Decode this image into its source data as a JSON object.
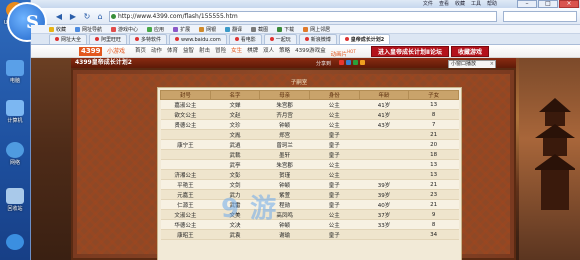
{
  "desktop": {
    "icons": [
      {
        "label": "UC浏览器",
        "color": "#e98b1c"
      },
      {
        "label": "电脑",
        "color": "#5aa0e8"
      },
      {
        "label": "计算机",
        "color": "#7cb7f2"
      },
      {
        "label": "网络",
        "color": "#4f9be0"
      },
      {
        "label": "回收站",
        "color": "#a9c9ea"
      },
      {
        "label": "IE",
        "color": "#3b8fe0"
      }
    ]
  },
  "browser": {
    "system_menu": [
      "文件",
      "查看",
      "收藏",
      "工具",
      "帮助"
    ],
    "url": "http://www.4399.com/flash/155555.htm",
    "bookmarks": [
      {
        "label": "收藏",
        "color": "#e7b416"
      },
      {
        "label": "网址导航",
        "color": "#4c8be0"
      },
      {
        "label": "游戏中心",
        "color": "#e04c4c"
      },
      {
        "label": "应用",
        "color": "#48a848"
      },
      {
        "label": "扩展",
        "color": "#8a58c8"
      },
      {
        "label": "网银",
        "color": "#d08a2a"
      },
      {
        "label": "翻译",
        "color": "#3a9ac8"
      },
      {
        "label": "截图",
        "color": "#7a7a7a"
      },
      {
        "label": "下载",
        "color": "#3a8a3a"
      },
      {
        "label": "网上邻居",
        "color": "#e07a2a"
      }
    ],
    "tabs": [
      {
        "label": "网址大全",
        "active": false
      },
      {
        "label": "阿里旺旺",
        "active": false
      },
      {
        "label": "多特软件",
        "active": false
      },
      {
        "label": "www.baidu.com",
        "active": false
      },
      {
        "label": "看电影",
        "active": false
      },
      {
        "label": "一起玩",
        "active": false
      },
      {
        "label": "新浪微博",
        "active": false
      },
      {
        "label": "皇帝成长计划2",
        "active": true
      }
    ]
  },
  "site": {
    "logo": "4399",
    "logo_text": "小游戏",
    "nav": [
      "首页",
      "动作",
      "体育",
      "益智",
      "射击",
      "冒险",
      "女生",
      "棋牌",
      "双人",
      "策略",
      "4399游戏盒",
      "动画片"
    ],
    "highlight_items": [
      "女生",
      "动画片"
    ],
    "hot_badge": "HOT",
    "btn_enter": "进入皇帝成长计划Ⅱ论坛",
    "btn_favorite": "收藏游戏"
  },
  "game": {
    "title": "4399皇帝成长计划2",
    "share_label": "分享到",
    "share_colors": [
      "#e8372c",
      "#3a7fd0",
      "#2aa03a",
      "#f0a020"
    ],
    "room_label": "子嗣室",
    "mini_window_label": "小窗口播放",
    "watermark": "9 游",
    "table": {
      "headers": [
        "封号",
        "名字",
        "母亲",
        "身份",
        "年龄",
        "子女"
      ],
      "rows": [
        [
          "嘉淑公主",
          "文婵",
          "朱宫郡",
          "公主",
          "41岁",
          "13"
        ],
        [
          "欲文公主",
          "文赵",
          "齐月宫",
          "公主",
          "41岁",
          "8"
        ],
        [
          "贤德公主",
          "文珍",
          "钟颖",
          "公主",
          "43岁",
          "7"
        ],
        [
          "",
          "文胤",
          "郑宫",
          "皇子",
          "",
          "21"
        ],
        [
          "康宁王",
          "武逍",
          "曾珂兰",
          "皇子",
          "",
          "20"
        ],
        [
          "",
          "武裁",
          "墨轩",
          "皇子",
          "",
          "18"
        ],
        [
          "",
          "武亭",
          "朱宫郡",
          "公主",
          "",
          "13"
        ],
        [
          "济湘公主",
          "文彭",
          "贺瑾",
          "公主",
          "",
          "13"
        ],
        [
          "平艳王",
          "文剑",
          "钟颖",
          "皇子",
          "39岁",
          "21"
        ],
        [
          "元嘉王",
          "武力",
          "紫萱",
          "皇子",
          "39岁",
          "23"
        ],
        [
          "仁源王",
          "武雷",
          "程勋",
          "皇子",
          "40岁",
          "21"
        ],
        [
          "文淑公主",
          "文美",
          "高凤鸣",
          "公主",
          "37岁",
          "9"
        ],
        [
          "华德公主",
          "文决",
          "钟颖",
          "公主",
          "33岁",
          "8"
        ],
        [
          "康昭王",
          "武袁",
          "谢瑜",
          "皇子",
          "",
          "34"
        ]
      ]
    }
  }
}
